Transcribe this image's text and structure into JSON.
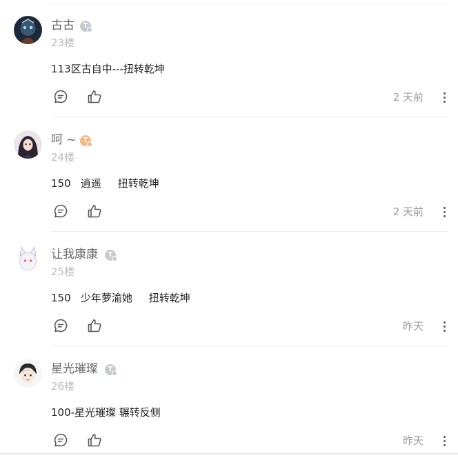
{
  "comments": [
    {
      "username": "古古",
      "badge": "T",
      "floor": "23楼",
      "content": "113区古自中---扭转乾坤",
      "time": "2 天前"
    },
    {
      "username": "呵 ~",
      "badge": "T",
      "floor": "24楼",
      "content": "150   逍遥     扭转乾坤",
      "time": "2 天前"
    },
    {
      "username": "让我康康",
      "badge": "T",
      "floor": "25楼",
      "content": "150   少年萝渝她     扭转乾坤",
      "time": "昨天"
    },
    {
      "username": "星光璀璨",
      "badge": "T",
      "floor": "26楼",
      "content": "100-星光璀璨 辗转反侧",
      "time": "昨天"
    }
  ],
  "icons": {
    "reply": "comment-bubble-icon",
    "like": "thumbs-up-icon",
    "more": "more-vertical-icon"
  },
  "colors": {
    "text": "#222222",
    "muted": "#9a9a9a",
    "badge_gray": "#c7cbd1",
    "badge_gold": "#f4b98a"
  }
}
